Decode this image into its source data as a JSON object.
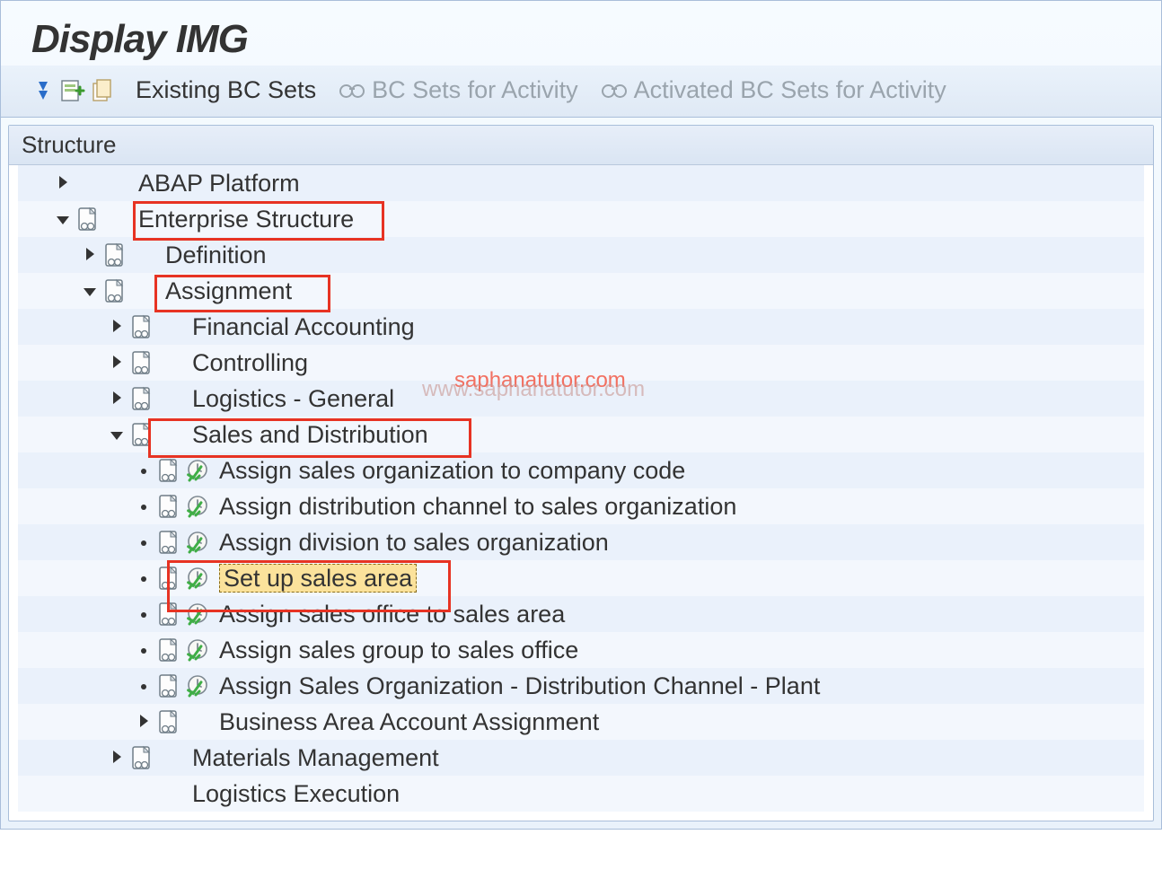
{
  "title": "Display IMG",
  "toolbar": {
    "existing_bc_sets": "Existing BC Sets",
    "bc_sets_for_activity": "BC Sets for Activity",
    "activated_bc_sets": "Activated BC Sets for Activity"
  },
  "tree_header": "Structure",
  "watermark": {
    "text1": "saphanatutor.com",
    "text2": "www.saphanatutor.com"
  },
  "tree": {
    "abap_platform": "ABAP Platform",
    "enterprise_structure": "Enterprise Structure",
    "definition": "Definition",
    "assignment": "Assignment",
    "financial_accounting": "Financial Accounting",
    "controlling": "Controlling",
    "logistics_general": "Logistics - General",
    "sales_and_distribution": "Sales and Distribution",
    "assign_sales_org_cc": "Assign sales organization to company code",
    "assign_dist_channel": "Assign distribution channel to sales organization",
    "assign_division": "Assign division to sales organization",
    "set_up_sales_area": "Set up sales area",
    "assign_sales_office": "Assign sales office to sales area",
    "assign_sales_group": "Assign sales group to sales office",
    "assign_sales_org_dc_plant": "Assign Sales Organization - Distribution Channel - Plant",
    "business_area": "Business Area Account Assignment",
    "materials_management": "Materials Management",
    "logistics_execution": "Logistics Execution"
  }
}
